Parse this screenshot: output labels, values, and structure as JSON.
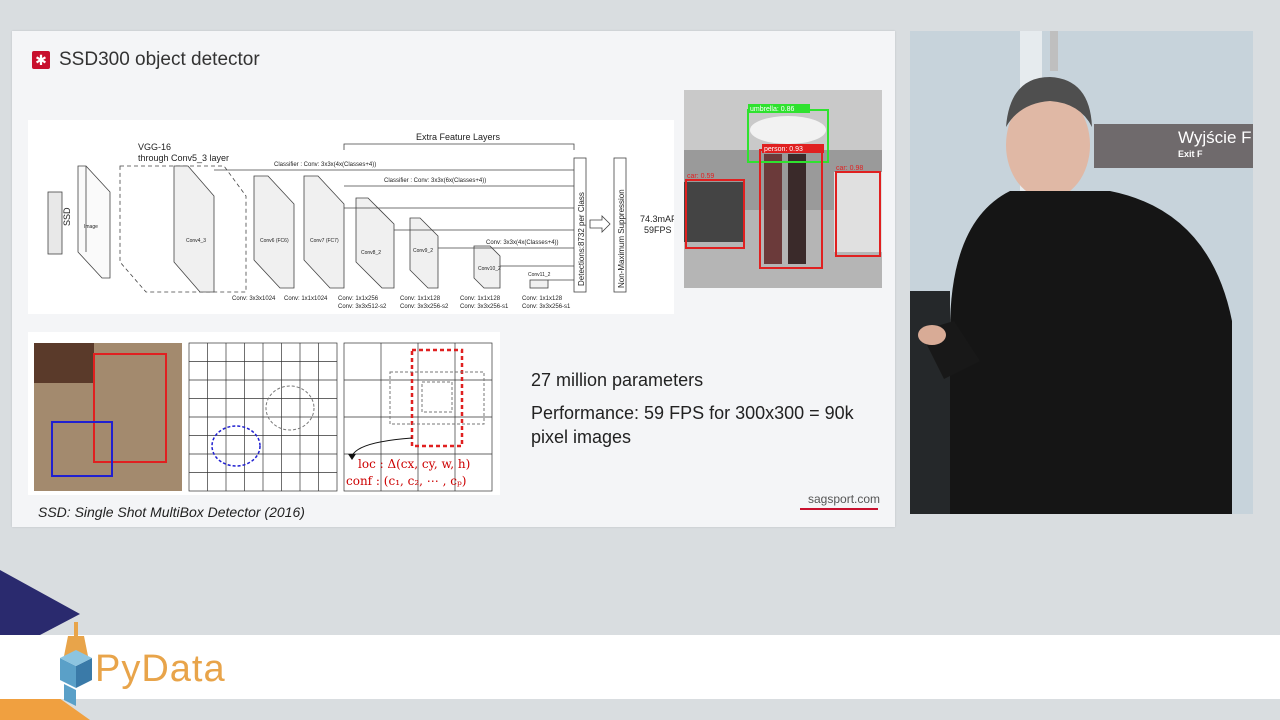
{
  "slide": {
    "title": "SSD300 object detector",
    "caption": "SSD: Single Shot MultiBox Detector (2016)",
    "brand": "sagsport.com",
    "facts": {
      "params": "27 million parameters",
      "performance": "Performance: 59 FPS for 300x300 = 90k pixel images"
    },
    "architecture": {
      "ssd_label": "SSD",
      "vgg_label": "VGG-16",
      "vgg_sub": "through Conv5_3 layer",
      "extra_layers": "Extra Feature Layers",
      "classifier1": "Classifier : Conv: 3x3x(4x(Classes+4))",
      "classifier2": "Classifier : Conv: 3x3x(6x(Classes+4))",
      "classifier3": "Conv: 3x3x(4x(Classes+4))",
      "detections": "Detections:8732 per Class",
      "nms": "Non-Maximum Suppression",
      "map": "74.3mAP",
      "fps": "59FPS",
      "image_label": "Image",
      "conv43": "Conv4_3",
      "conv6": "Conv6 (FC6)",
      "conv7": "Conv7 (FC7)",
      "conv82": "Conv8_2",
      "conv92": "Conv9_2",
      "conv102": "Conv10_2",
      "conv112": "Conv11_2",
      "bottom_labels": [
        "Conv: 3x3x1024",
        "Conv: 1x1x1024",
        "Conv: 1x1x256",
        "Conv: 3x3x512-s2",
        "Conv: 1x1x128",
        "Conv: 3x3x256-s2",
        "Conv: 1x1x128",
        "Conv: 3x3x256-s1",
        "Conv: 1x1x128",
        "Conv: 3x3x256-s1"
      ]
    },
    "photo_labels": {
      "umbrella": "umbrella: 0.86",
      "person": "person: 0.93",
      "car_left": "car: 0.59",
      "car_right": "car: 0.98"
    },
    "grid_labels": {
      "loc": "loc : Δ(cx, cy, w, h)",
      "conf": "conf : (c₁, c₂, ⋯ , cₚ)"
    }
  },
  "video": {
    "sign_main": "Wyjście F",
    "sign_sub": "Exit F"
  },
  "banner": {
    "logo_text": "PyData"
  },
  "colors": {
    "accent": "#c8102e",
    "pydata_orange": "#e8a44a",
    "pydata_navy": "#2a2a6e"
  }
}
